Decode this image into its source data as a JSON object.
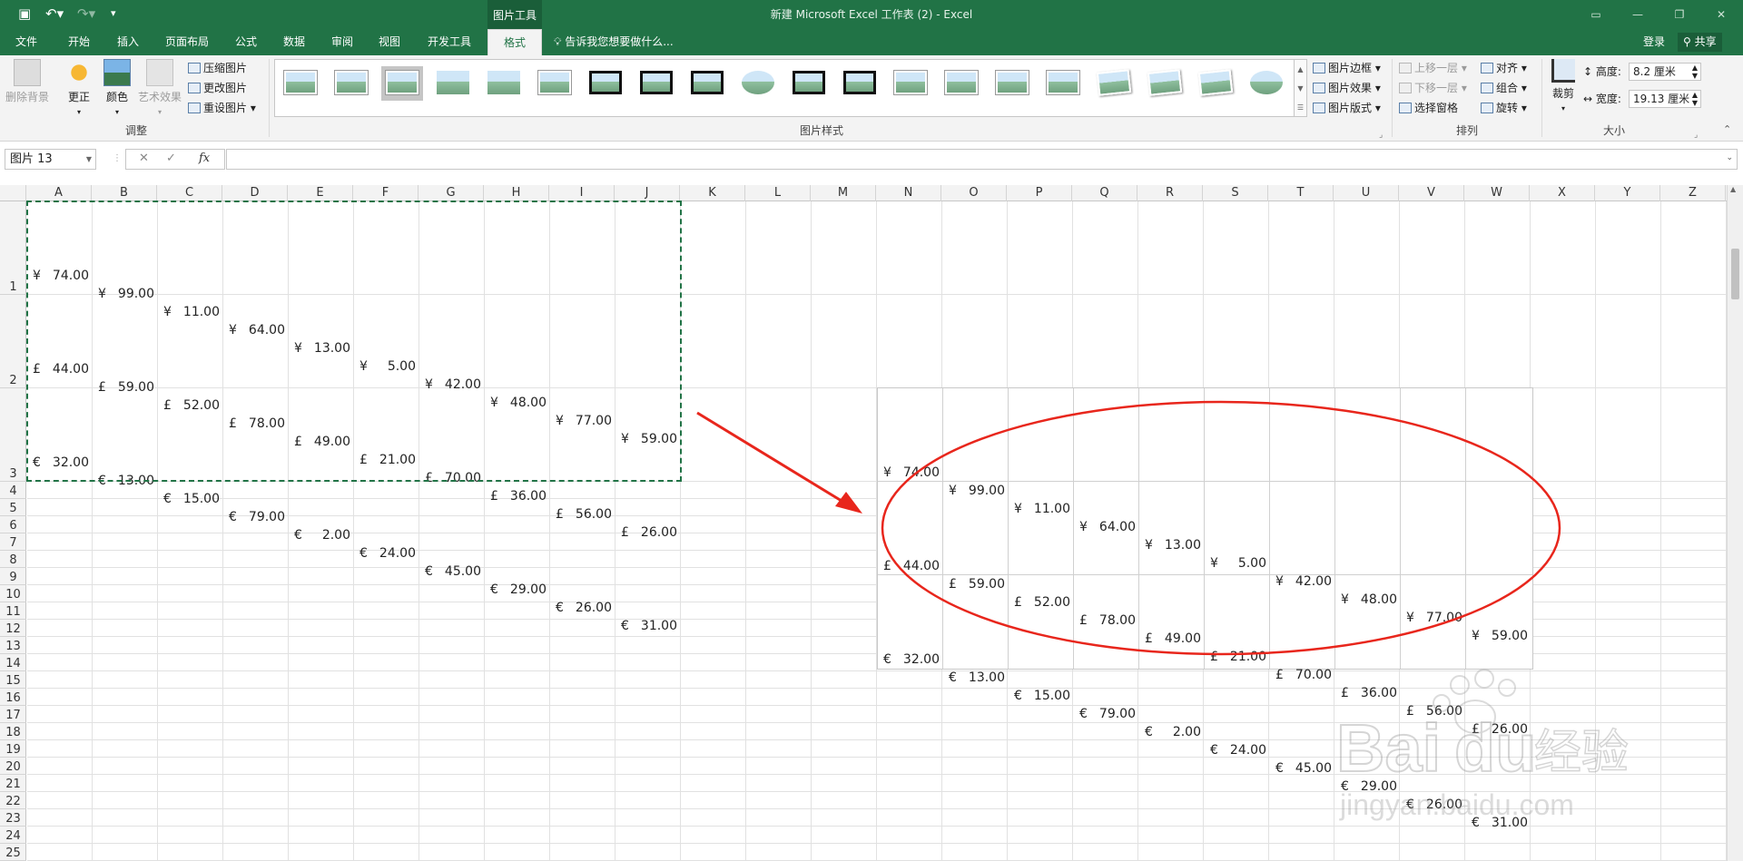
{
  "title_bar": {
    "window_title": "新建 Microsoft Excel 工作表 (2) - Excel",
    "context_tab": "图片工具"
  },
  "tabs": [
    {
      "label": "文件"
    },
    {
      "label": "开始"
    },
    {
      "label": "插入"
    },
    {
      "label": "页面布局"
    },
    {
      "label": "公式"
    },
    {
      "label": "数据"
    },
    {
      "label": "审阅"
    },
    {
      "label": "视图"
    },
    {
      "label": "开发工具"
    },
    {
      "label": "格式"
    }
  ],
  "tell_me": "告诉我您想要做什么...",
  "account": {
    "login": "登录",
    "share": "共享"
  },
  "ribbon": {
    "adjust": {
      "remove_bg": "删除背景",
      "corrections": "更正",
      "color": "颜色",
      "artistic": "艺术效果",
      "compress": "压缩图片",
      "change": "更改图片",
      "reset": "重设图片",
      "group_label": "调整"
    },
    "styles": {
      "border": "图片边框",
      "effects": "图片效果",
      "layout": "图片版式",
      "group_label": "图片样式"
    },
    "arrange": {
      "bring_forward": "上移一层",
      "send_backward": "下移一层",
      "selection_pane": "选择窗格",
      "align": "对齐",
      "group": "组合",
      "rotate": "旋转",
      "group_label": "排列"
    },
    "size": {
      "crop": "裁剪",
      "height_label": "高度:",
      "height_value": "8.2 厘米",
      "width_label": "宽度:",
      "width_value": "19.13 厘米",
      "group_label": "大小"
    }
  },
  "formula_bar": {
    "name_box": "图片 13",
    "fx": "fx",
    "formula": ""
  },
  "columns": [
    "A",
    "B",
    "C",
    "D",
    "E",
    "F",
    "G",
    "H",
    "I",
    "J",
    "K",
    "L",
    "M",
    "N",
    "O",
    "P",
    "Q",
    "R",
    "S",
    "T",
    "U",
    "V",
    "W",
    "X",
    "Y",
    "Z"
  ],
  "rows": [
    "1",
    "2",
    "3",
    "4",
    "5",
    "6",
    "7",
    "8",
    "9",
    "10",
    "11",
    "12",
    "13",
    "14",
    "15",
    "16",
    "17",
    "18",
    "19",
    "20",
    "21",
    "22",
    "23",
    "24",
    "25"
  ],
  "sheet": {
    "row1": {
      "currency": "¥",
      "values": [
        "74.00",
        "99.00",
        "11.00",
        "64.00",
        "13.00",
        "5.00",
        "42.00",
        "48.00",
        "77.00",
        "59.00"
      ]
    },
    "row2": {
      "currency": "£",
      "values": [
        "44.00",
        "59.00",
        "52.00",
        "78.00",
        "49.00",
        "21.00",
        "70.00",
        "36.00",
        "56.00",
        "26.00"
      ]
    },
    "row3": {
      "currency": "€",
      "values": [
        "32.00",
        "13.00",
        "15.00",
        "79.00",
        "2.00",
        "24.00",
        "45.00",
        "29.00",
        "26.00",
        "31.00"
      ]
    }
  },
  "annotation_colors": {
    "arrow": "#e8261c",
    "ellipse": "#e8261c",
    "marquee": "#217346"
  },
  "watermark": {
    "text1": "Bai",
    "text2": "du",
    "text3": "经验",
    "url": "jingyan.baidu.com"
  }
}
